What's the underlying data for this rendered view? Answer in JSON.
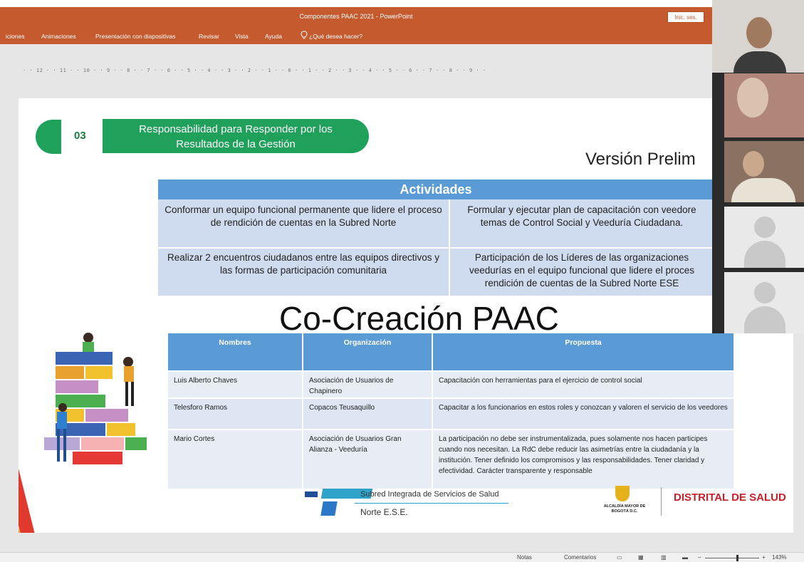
{
  "window": {
    "title": "Componentes PAAC 2021 - PowerPoint",
    "signin_label": "Inic. ses."
  },
  "menu": {
    "items": [
      "iciones",
      "Animaciones",
      "Presentación con diapositivas",
      "Revisar",
      "Vista",
      "Ayuda"
    ],
    "tell_me": "¿Qué desea hacer?"
  },
  "ruler": {
    "text": "·  ·  12  ·  ·  11  ·  ·  10  ·  ·  9  ·  ·  8  ·  ·  7  ·  ·  6  ·  ·  5  ·  ·  4  ·  ·  3  ·  ·  2  ·  ·  1  ·  ·  0  ·  ·  1  ·  ·  2  ·  ·  3  ·  ·  4  ·  ·  5  ·  ·  6  ·  ·  7  ·  ·  8  ·  ·  9  ·  ·"
  },
  "slide": {
    "section_number": "03",
    "section_title_line1": "Responsabilidad para Responder por los",
    "section_title_line2": "Resultados de la Gestión",
    "version_text": "Versión Prelim",
    "activities": {
      "header": "Actividades",
      "items": [
        "Conformar un equipo funcional permanente que lidere el proceso de rendición de cuentas en la Subred Norte",
        "Formular y ejecutar plan de capacitación con veedore temas de Control Social y Veeduría Ciudadana.",
        "Realizar 2 encuentros ciudadanos entre las equipos directivos y las formas de participación comunitaria",
        "Participación de los Líderes de las organizaciones veedurías en el equipo funcional que lidere el proces rendición de cuentas de la Subred Norte ESE"
      ]
    },
    "cocreation_title": "Co-Creación PAAC",
    "cocreation_table": {
      "headers": [
        "Nombres",
        "Organización",
        "Propuesta"
      ],
      "rows": [
        {
          "nombre": "Luis Alberto Chaves",
          "organizacion": "Asociación de Usuarios de Chapinero",
          "propuesta": "Capacitación con herramientas para el ejercicio de control social"
        },
        {
          "nombre": "Telesforo Ramos",
          "organizacion": "Copacos Teusaquillo",
          "propuesta": "Capacitar a los funcionarios en estos roles y conozcan y valoren el servicio de los veedores"
        },
        {
          "nombre": "Mario Cortes",
          "organizacion": "Asociación de Usuarios Gran Alianza - Veeduría",
          "propuesta": "La participación no debe ser instrumentalizada, pues solamente nos hacen participes cuando nos necesitan. La RdC debe reducir las asimetrías entre la ciudadanía y la institución. Tener definido los compromisos y las responsabilidades. Tener claridad y efectividad. Carácter transparente y responsable"
        }
      ]
    },
    "footer": {
      "subred": "Subred Integrada de Servicios de Salud",
      "norte": "Norte E.S.E.",
      "alcaldia": "ALCALDÍA MAYOR DE BOGOTÁ D.C.",
      "distrital": "DISTRITAL DE SALUD"
    }
  },
  "statusbar": {
    "notes_label": "Notas",
    "comments_label": "Comentarios",
    "zoom": "143%"
  },
  "colors": {
    "ribbon": "#c55a2f",
    "green": "#1fa15b",
    "table_blue": "#5b9bd5",
    "distrital_red": "#c8202b"
  }
}
